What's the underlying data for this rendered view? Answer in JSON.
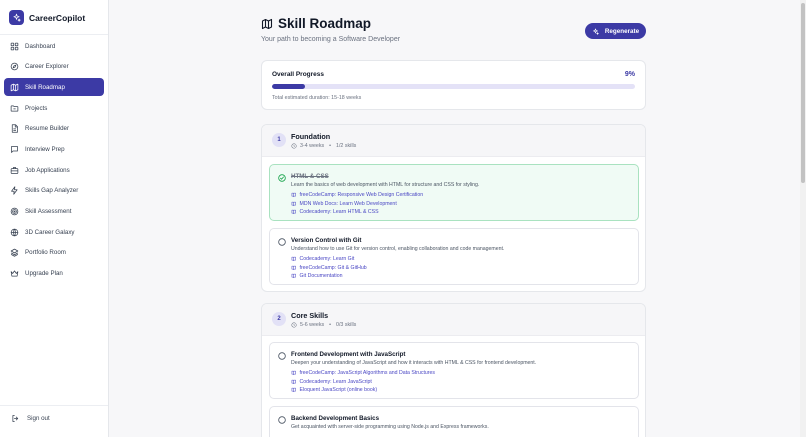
{
  "app": {
    "name": "CareerCopilot"
  },
  "sidebar": {
    "items": [
      {
        "label": "Dashboard",
        "icon": "dashboard-icon",
        "active": false
      },
      {
        "label": "Career Explorer",
        "icon": "compass-icon",
        "active": false
      },
      {
        "label": "Skill Roadmap",
        "icon": "map-icon",
        "active": true
      },
      {
        "label": "Projects",
        "icon": "folder-icon",
        "active": false
      },
      {
        "label": "Resume Builder",
        "icon": "document-icon",
        "active": false
      },
      {
        "label": "Interview Prep",
        "icon": "chat-icon",
        "active": false
      },
      {
        "label": "Job Applications",
        "icon": "briefcase-icon",
        "active": false
      },
      {
        "label": "Skills Gap Analyzer",
        "icon": "lightning-icon",
        "active": false
      },
      {
        "label": "Skill Assessment",
        "icon": "target-icon",
        "active": false
      },
      {
        "label": "3D Career Galaxy",
        "icon": "globe-icon",
        "active": false
      },
      {
        "label": "Portfolio Room",
        "icon": "layers-icon",
        "active": false
      },
      {
        "label": "Upgrade Plan",
        "icon": "crown-icon",
        "active": false
      }
    ],
    "signout_label": "Sign out"
  },
  "header": {
    "title": "Skill Roadmap",
    "subtitle": "Your path to becoming a Software Developer",
    "regenerate_label": "Regenerate"
  },
  "progress": {
    "label": "Overall Progress",
    "percent_text": "9%",
    "fraction": 0.09,
    "duration": "Total estimated duration: 15-18 weeks"
  },
  "phases": [
    {
      "number": "1",
      "title": "Foundation",
      "duration": "3-4 weeks",
      "skills_count": "1/2 skills",
      "skills": [
        {
          "title": "HTML & CSS",
          "completed": true,
          "description": "Learn the basics of web development with HTML for structure and CSS for styling.",
          "resources": [
            "freeCodeCamp: Responsive Web Design Certification",
            "MDN Web Docs: Learn Web Development",
            "Codecademy: Learn HTML & CSS"
          ]
        },
        {
          "title": "Version Control with Git",
          "completed": false,
          "description": "Understand how to use Git for version control, enabling collaboration and code management.",
          "resources": [
            "Codecademy: Learn Git",
            "freeCodeCamp: Git & GitHub",
            "Git Documentation"
          ]
        }
      ]
    },
    {
      "number": "2",
      "title": "Core Skills",
      "duration": "5-6 weeks",
      "skills_count": "0/3 skills",
      "skills": [
        {
          "title": "Frontend Development with JavaScript",
          "completed": false,
          "description": "Deepen your understanding of JavaScript and how it interacts with HTML & CSS for frontend development.",
          "resources": [
            "freeCodeCamp: JavaScript Algorithms and Data Structures",
            "Codecademy: Learn JavaScript",
            "Eloquent JavaScript (online book)"
          ]
        },
        {
          "title": "Backend Development Basics",
          "completed": false,
          "description": "Get acquainted with server-side programming using Node.js and Express frameworks.",
          "resources": []
        }
      ]
    }
  ],
  "colors": {
    "accent": "#3c3aa5",
    "done_bg": "#f0fbf5",
    "done_border": "#a9e2c0",
    "link": "#4a47c4"
  }
}
